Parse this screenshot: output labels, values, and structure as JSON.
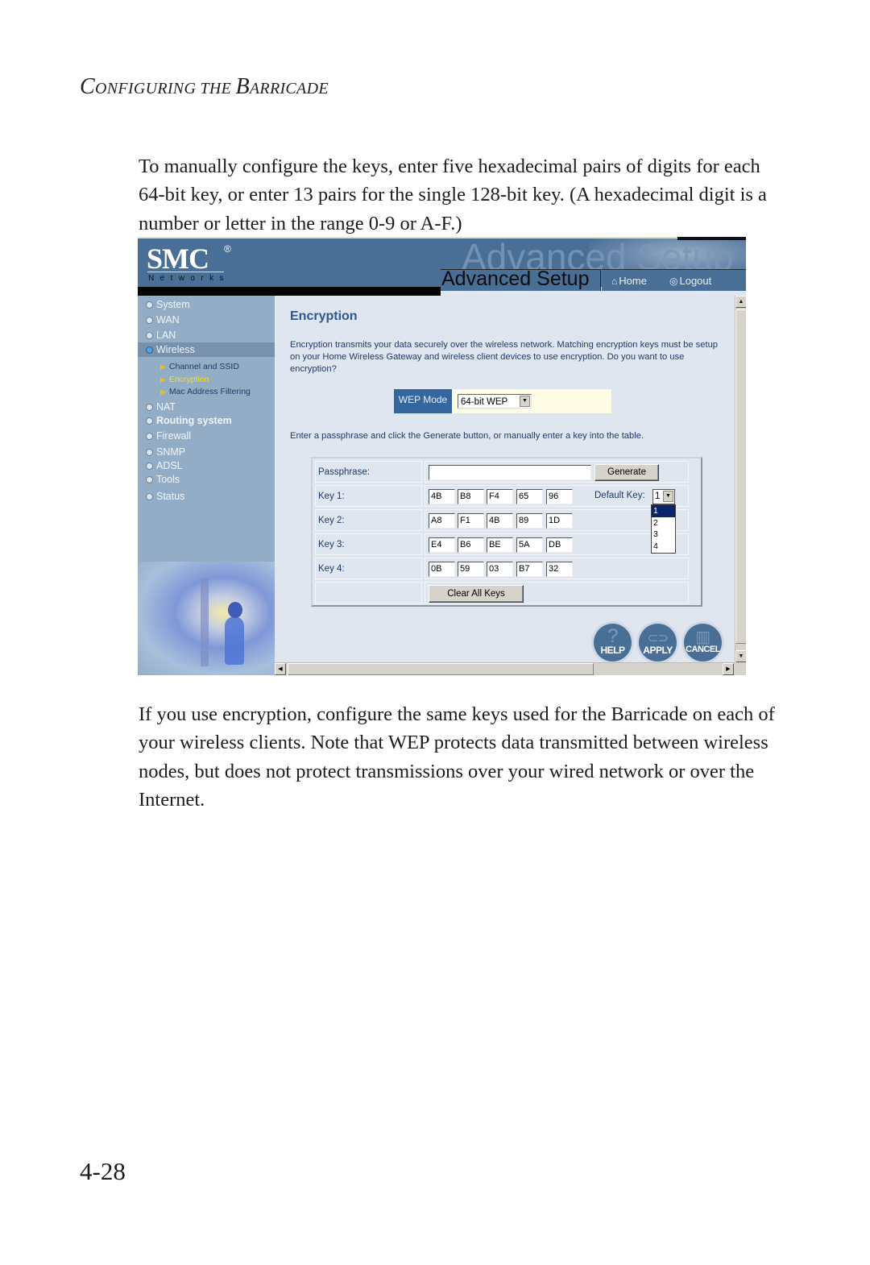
{
  "page": {
    "running_head": {
      "first_cap": "C",
      "first_rest": "ONFIGURING",
      "mid": " THE ",
      "second_cap": "B",
      "second_rest": "ARRICADE"
    },
    "paragraph_1": "To manually configure the keys, enter five hexadecimal pairs of digits for each 64-bit key, or enter 13 pairs for the single 128-bit key. (A hexadecimal digit is a number or letter in the range 0-9 or A-F.)",
    "paragraph_2": "If you use encryption, configure the same keys used for the Barricade on each of your wireless clients. Note that WEP protects data transmitted between wireless nodes, but does not protect transmissions over your wired network or over the Internet.",
    "page_number": "4-28"
  },
  "screenshot": {
    "header": {
      "logo": "SMC",
      "logo_registered": "®",
      "logo_sub": "Networks",
      "banner_ghost_text": "Advanced Setup",
      "title": "Advanced Setup",
      "nav": {
        "home": "Home",
        "home_icon": "⌂",
        "logout": "Logout",
        "logout_icon": "◎"
      }
    },
    "sidebar": {
      "items": [
        {
          "label": "System"
        },
        {
          "label": "WAN"
        },
        {
          "label": "LAN"
        },
        {
          "label": "Wireless",
          "active": true
        },
        {
          "label": "NAT"
        },
        {
          "label": "Routing system"
        },
        {
          "label": "Firewall"
        },
        {
          "label": "SNMP"
        },
        {
          "label": "ADSL"
        },
        {
          "label": "Tools"
        },
        {
          "label": "Status"
        }
      ],
      "sub_items": [
        {
          "label": "Channel and SSID"
        },
        {
          "label": "Encryption",
          "current": true
        },
        {
          "label": "Mac Address Filtering"
        }
      ],
      "sub_icon": "▶"
    },
    "content": {
      "title": "Encryption",
      "description": "Encryption transmits your data securely over the wireless network. Matching encryption keys must be setup on your Home Wireless Gateway and wireless client devices to use encryption. Do you want to use encryption?",
      "wep_mode_label": "WEP Mode",
      "wep_mode_value": "64-bit WEP",
      "hint": "Enter a passphrase and click the Generate button, or manually enter a key into the table.",
      "passphrase_label": "Passphrase:",
      "passphrase_value": "",
      "generate_label": "Generate",
      "keys": [
        {
          "label": "Key 1:",
          "values": [
            "4B",
            "B8",
            "F4",
            "65",
            "96"
          ]
        },
        {
          "label": "Key 2:",
          "values": [
            "A8",
            "F1",
            "4B",
            "89",
            "1D"
          ]
        },
        {
          "label": "Key 3:",
          "values": [
            "E4",
            "B6",
            "BE",
            "5A",
            "DB"
          ]
        },
        {
          "label": "Key 4:",
          "values": [
            "0B",
            "59",
            "03",
            "B7",
            "32"
          ]
        }
      ],
      "default_key_label": "Default Key:",
      "default_key_value": "1",
      "default_key_options": [
        "1",
        "2",
        "3",
        "4"
      ],
      "clear_label": "Clear All Keys",
      "dropdown_arrow": "▼"
    },
    "actions": {
      "help": "HELP",
      "help_glyph": "?",
      "apply": "APPLY",
      "apply_glyph": "⊂⊃",
      "cancel": "CANCEL",
      "cancel_glyph": "▥"
    },
    "scrollbars": {
      "up": "▲",
      "down": "▼",
      "left": "◀",
      "right": "▶"
    }
  }
}
